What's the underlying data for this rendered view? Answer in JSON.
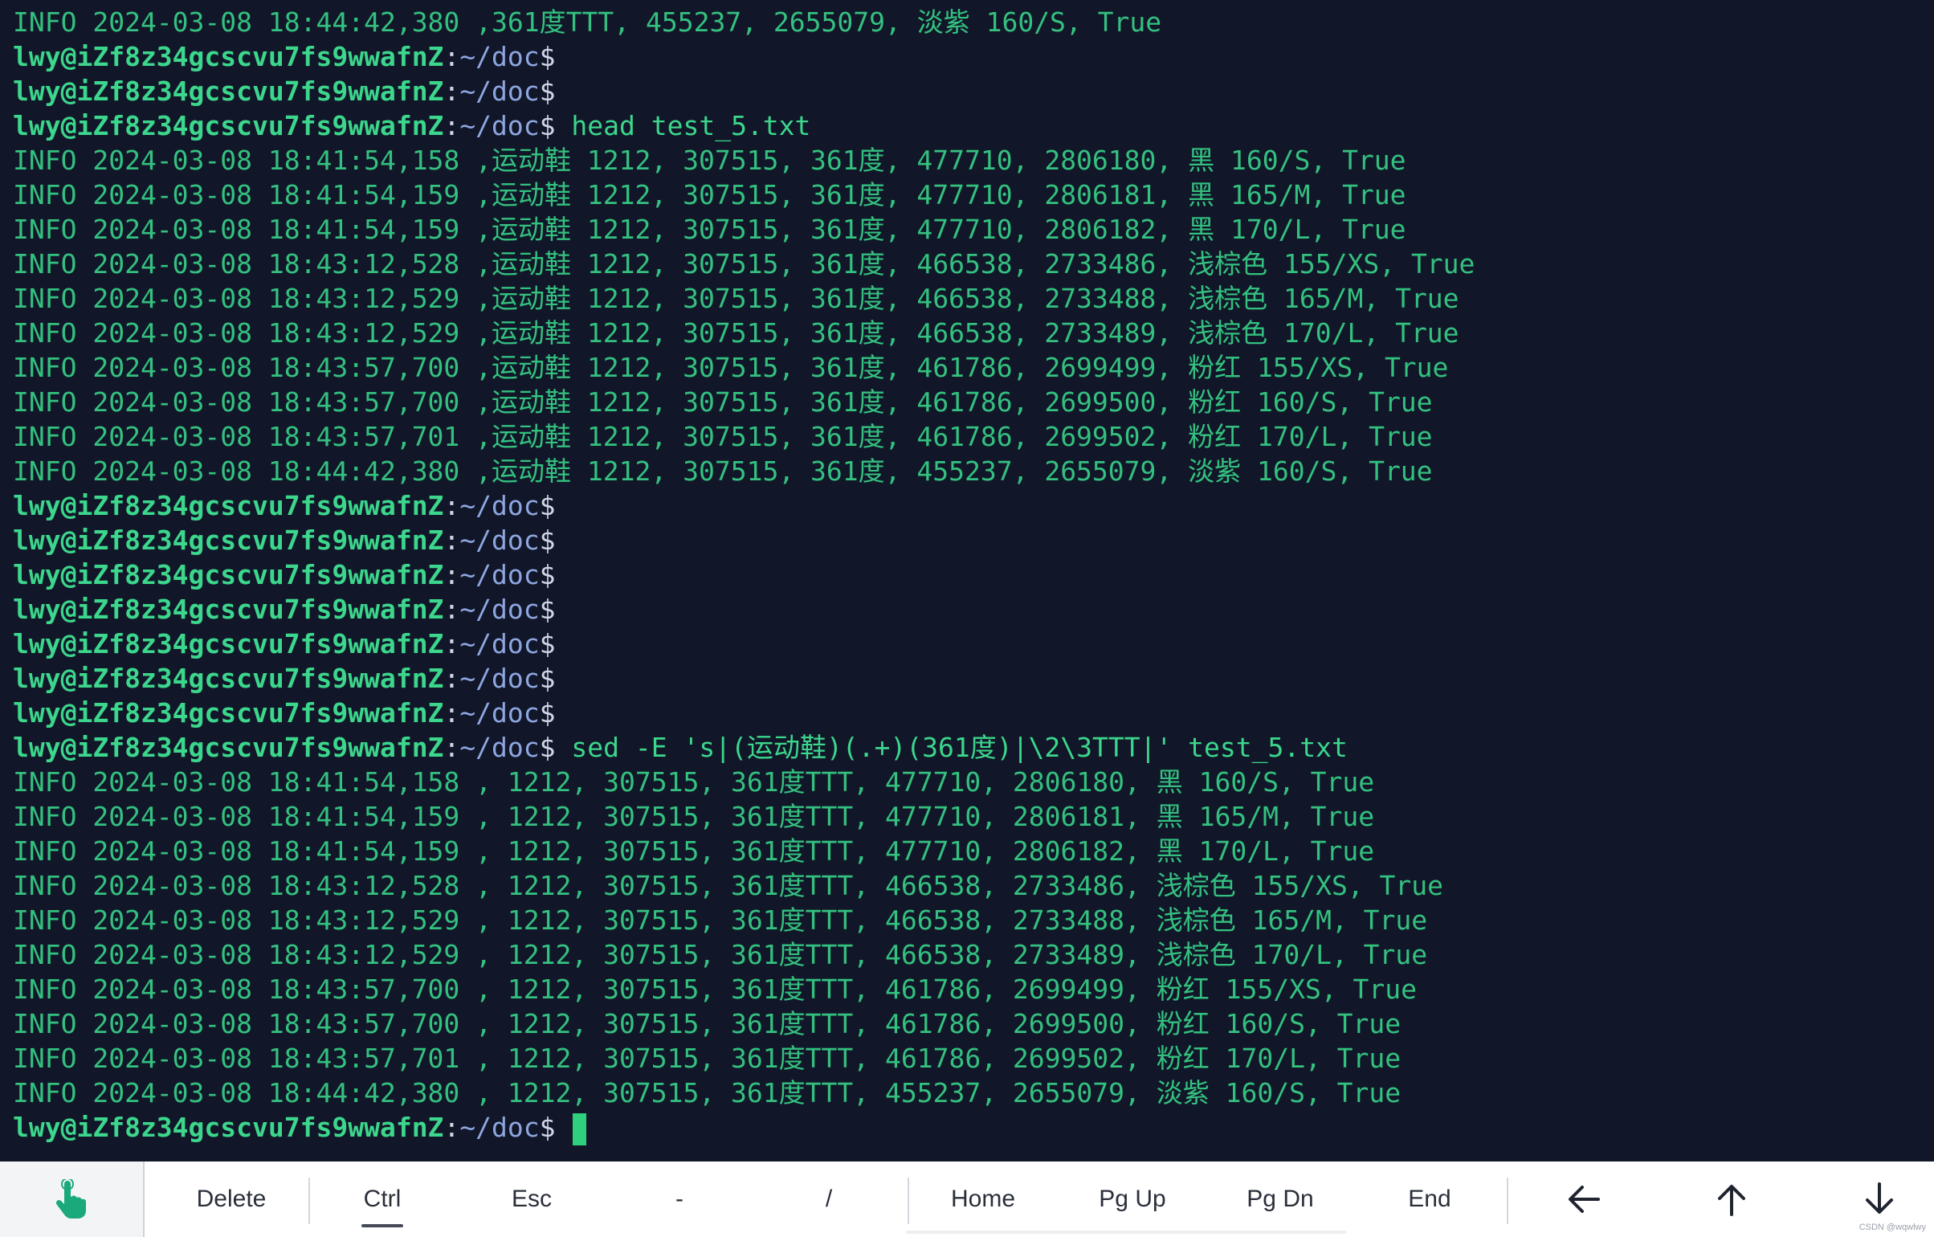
{
  "terminal": {
    "prompt": {
      "user_host": "lwy@iZf8z34gcscvu7fs9wwafnZ",
      "colon": ":",
      "path": "~/doc",
      "dollar": "$"
    },
    "lines": [
      {
        "type": "output",
        "text": "INFO 2024-03-08 18:44:42,380 ,361度TTT, 455237, 2655079, 淡紫 160/S, True"
      },
      {
        "type": "prompt",
        "cmd": ""
      },
      {
        "type": "prompt",
        "cmd": ""
      },
      {
        "type": "prompt",
        "cmd": " head test_5.txt"
      },
      {
        "type": "output",
        "text": "INFO 2024-03-08 18:41:54,158 ,运动鞋 1212, 307515, 361度, 477710, 2806180, 黑 160/S, True"
      },
      {
        "type": "output",
        "text": "INFO 2024-03-08 18:41:54,159 ,运动鞋 1212, 307515, 361度, 477710, 2806181, 黑 165/M, True"
      },
      {
        "type": "output",
        "text": "INFO 2024-03-08 18:41:54,159 ,运动鞋 1212, 307515, 361度, 477710, 2806182, 黑 170/L, True"
      },
      {
        "type": "output",
        "text": "INFO 2024-03-08 18:43:12,528 ,运动鞋 1212, 307515, 361度, 466538, 2733486, 浅棕色 155/XS, True"
      },
      {
        "type": "output",
        "text": "INFO 2024-03-08 18:43:12,529 ,运动鞋 1212, 307515, 361度, 466538, 2733488, 浅棕色 165/M, True"
      },
      {
        "type": "output",
        "text": "INFO 2024-03-08 18:43:12,529 ,运动鞋 1212, 307515, 361度, 466538, 2733489, 浅棕色 170/L, True"
      },
      {
        "type": "output",
        "text": "INFO 2024-03-08 18:43:57,700 ,运动鞋 1212, 307515, 361度, 461786, 2699499, 粉红 155/XS, True"
      },
      {
        "type": "output",
        "text": "INFO 2024-03-08 18:43:57,700 ,运动鞋 1212, 307515, 361度, 461786, 2699500, 粉红 160/S, True"
      },
      {
        "type": "output",
        "text": "INFO 2024-03-08 18:43:57,701 ,运动鞋 1212, 307515, 361度, 461786, 2699502, 粉红 170/L, True"
      },
      {
        "type": "output",
        "text": "INFO 2024-03-08 18:44:42,380 ,运动鞋 1212, 307515, 361度, 455237, 2655079, 淡紫 160/S, True"
      },
      {
        "type": "prompt",
        "cmd": ""
      },
      {
        "type": "prompt",
        "cmd": ""
      },
      {
        "type": "prompt",
        "cmd": ""
      },
      {
        "type": "prompt",
        "cmd": ""
      },
      {
        "type": "prompt",
        "cmd": ""
      },
      {
        "type": "prompt",
        "cmd": ""
      },
      {
        "type": "prompt",
        "cmd": ""
      },
      {
        "type": "prompt",
        "cmd": " sed -E 's|(运动鞋)(.+)(361度)|\\2\\3TTT|' test_5.txt"
      },
      {
        "type": "output",
        "text": "INFO 2024-03-08 18:41:54,158 , 1212, 307515, 361度TTT, 477710, 2806180, 黑 160/S, True"
      },
      {
        "type": "output",
        "text": "INFO 2024-03-08 18:41:54,159 , 1212, 307515, 361度TTT, 477710, 2806181, 黑 165/M, True"
      },
      {
        "type": "output",
        "text": "INFO 2024-03-08 18:41:54,159 , 1212, 307515, 361度TTT, 477710, 2806182, 黑 170/L, True"
      },
      {
        "type": "output",
        "text": "INFO 2024-03-08 18:43:12,528 , 1212, 307515, 361度TTT, 466538, 2733486, 浅棕色 155/XS, True"
      },
      {
        "type": "output",
        "text": "INFO 2024-03-08 18:43:12,529 , 1212, 307515, 361度TTT, 466538, 2733488, 浅棕色 165/M, True"
      },
      {
        "type": "output",
        "text": "INFO 2024-03-08 18:43:12,529 , 1212, 307515, 361度TTT, 466538, 2733489, 浅棕色 170/L, True"
      },
      {
        "type": "output",
        "text": "INFO 2024-03-08 18:43:57,700 , 1212, 307515, 361度TTT, 461786, 2699499, 粉红 155/XS, True"
      },
      {
        "type": "output",
        "text": "INFO 2024-03-08 18:43:57,700 , 1212, 307515, 361度TTT, 461786, 2699500, 粉红 160/S, True"
      },
      {
        "type": "output",
        "text": "INFO 2024-03-08 18:43:57,701 , 1212, 307515, 361度TTT, 461786, 2699502, 粉红 170/L, True"
      },
      {
        "type": "output",
        "text": "INFO 2024-03-08 18:44:42,380 , 1212, 307515, 361度TTT, 455237, 2655079, 淡紫 160/S, True"
      },
      {
        "type": "prompt",
        "cmd": " ",
        "cursor": true
      }
    ]
  },
  "keybar": {
    "touch_icon": "touch-hand-icon",
    "keys": {
      "delete": "Delete",
      "ctrl": "Ctrl",
      "esc": "Esc",
      "dash": "-",
      "slash": "/",
      "home": "Home",
      "pgup": "Pg Up",
      "pgdn": "Pg Dn",
      "end": "End"
    },
    "arrows": [
      "arrow-left-icon",
      "arrow-up-icon",
      "arrow-down-icon"
    ]
  },
  "watermark": "CSDN @wqwlwy",
  "colors": {
    "background": "#111729",
    "output_text": "#34c07f",
    "prompt_user": "#3cd68c",
    "prompt_path": "#8fa6e0",
    "cursor": "#2fd07d",
    "keybar_bg": "#ffffff"
  }
}
